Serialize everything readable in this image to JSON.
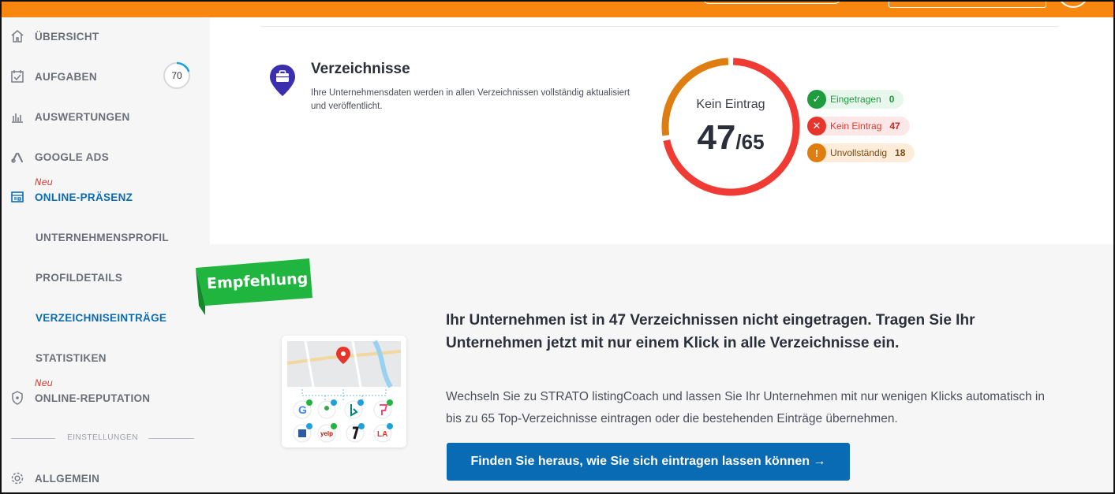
{
  "sidebar": {
    "items": [
      {
        "label": "ÜBERSICHT",
        "icon": "home-icon"
      },
      {
        "label": "AUFGABEN",
        "icon": "task-icon",
        "badge": "70"
      },
      {
        "label": "AUSWERTUNGEN",
        "icon": "chart-icon"
      },
      {
        "label": "GOOGLE ADS",
        "icon": "google-ads-icon"
      },
      {
        "label": "ONLINE-PRÄSENZ",
        "icon": "presence-icon",
        "tag": "Neu"
      },
      {
        "label": "UNTERNEHMENSPROFIL"
      },
      {
        "label": "PROFILDETAILS"
      },
      {
        "label": "VERZEICHNISEINTRÄGE"
      },
      {
        "label": "STATISTIKEN"
      },
      {
        "label": "ONLINE-REPUTATION",
        "icon": "shield-icon",
        "tag": "Neu"
      }
    ],
    "section_label": "EINSTELLUNGEN",
    "settings_item": {
      "label": "ALLGEMEIN",
      "icon": "gear-icon"
    },
    "badge_progress": 0.2
  },
  "directories": {
    "title": "Verzeichnisse",
    "description": "Ihre Unternehmensdaten werden in allen Verzeichnissen vollständig aktualisiert und veröffentlicht.",
    "donut_label": "Kein Eintrag",
    "count": "47",
    "total": "/65",
    "legend": [
      {
        "label": "Eingetragen",
        "count": "0",
        "color": "#1f9c3e"
      },
      {
        "label": "Kein Eintrag",
        "count": "47",
        "color": "#e8352c"
      },
      {
        "label": "Unvollständig",
        "count": "18",
        "color": "#df7e10"
      }
    ]
  },
  "recommendation": {
    "ribbon": "Empfehlung",
    "heading": "Ihr Unternehmen ist in 47 Verzeichnissen nicht eingetragen. Tragen Sie Ihr Unternehmen jetzt mit nur einem Klick in alle Verzeichnisse ein.",
    "text": "Wechseln Sie zu STRATO listingCoach und lassen Sie Ihr Unternehmen mit nur wenigen Klicks automatisch in bis zu 65 Top-Verzeichnisse eintragen oder die bestehenden Einträge übernehmen.",
    "button": "Finden Sie heraus, wie Sie sich eintragen lassen können →"
  }
}
